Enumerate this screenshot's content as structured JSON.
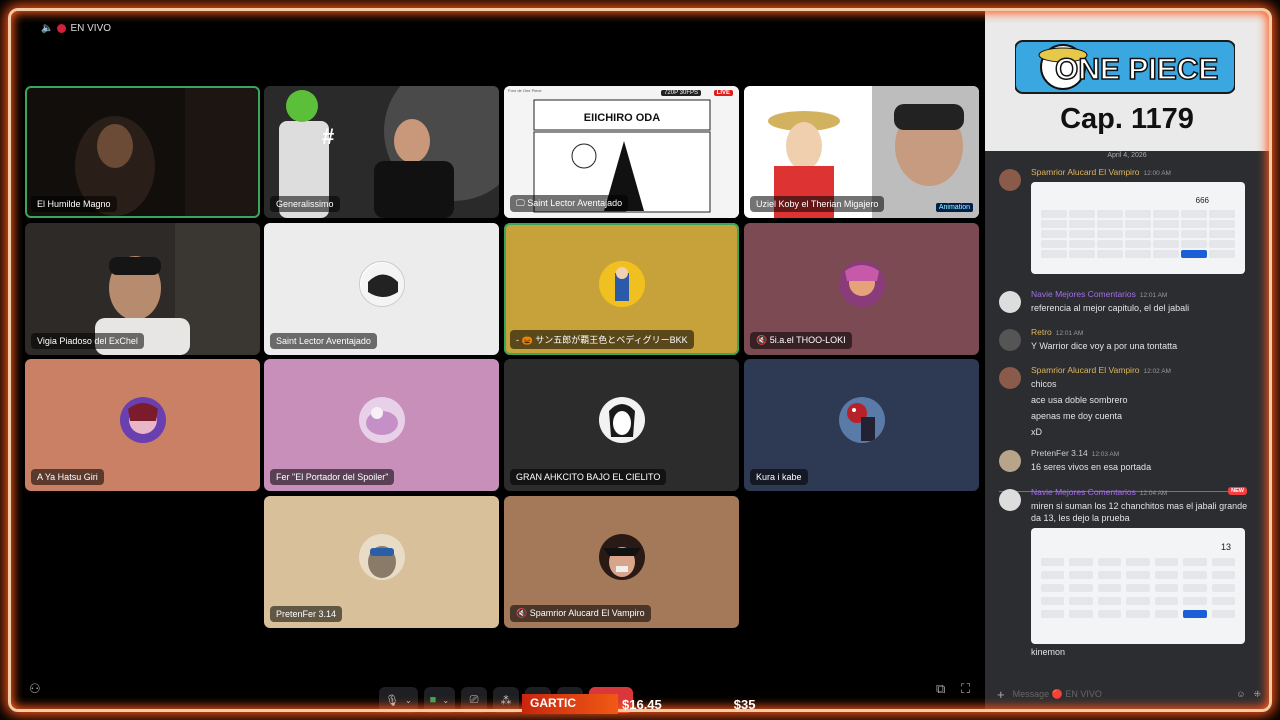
{
  "live_indicator": {
    "label": "EN VIVO"
  },
  "tiles": [
    {
      "name": "El Humilde Magno",
      "bg": "#1a1614"
    },
    {
      "name": "Generalissimo",
      "bg": "#2b2b2b"
    },
    {
      "name": "Saint Lector Aventajado",
      "bg": "#ffffff",
      "overlay": {
        "channel": "Foro de One Piece",
        "quality": "720P 30FPS",
        "live": "LIVE",
        "headline": "EIICHIRO ODA"
      }
    },
    {
      "name": "Uziel Koby el Therian Migajero",
      "bg": "#c5c5c5",
      "overlay": {
        "sponsor": "Animation"
      }
    },
    {
      "name": "Vigia Piadoso del ExChel",
      "bg": "#2d2a28"
    },
    {
      "name": "Saint Lector Aventajado",
      "bg": "#ececec"
    },
    {
      "name": "- 🎃 サン五郎が覇王色とベディグリーBKK",
      "bg": "#c7a13a"
    },
    {
      "name": "5i.a.el THOO-LOKI",
      "bg": "#7c4a52"
    },
    {
      "name": "A Ya Hatsu Giri",
      "bg": "#c98064"
    },
    {
      "name": "Fer \"El Portador del Spoiler\"",
      "bg": "#c78fba"
    },
    {
      "name": "GRAN AHKCITO BAJO EL CIELITO",
      "bg": "#2c2c2c"
    },
    {
      "name": "Kura i kabe",
      "bg": "#2e3953"
    },
    {
      "name": "PretenFer 3.14",
      "bg": "#d8c09a"
    },
    {
      "name": "Spamrior Alucard El Vampiro",
      "bg": "#a3795a"
    }
  ],
  "sidebar": {
    "logo_text": "ONE PIECE",
    "chapter": "Cap. 1179",
    "date": "April 4, 2026",
    "new_label": "NEW",
    "messages": [
      {
        "user": "Spamrior Alucard El Vampiro",
        "time": "12:00 AM",
        "lines": [],
        "calc_display": "666"
      },
      {
        "user": "Navie Mejores Comentarios",
        "time": "12:01 AM",
        "lines": [
          "referencia al mejor capitulo, el del jabali"
        ]
      },
      {
        "user": "Retro",
        "time": "12:01 AM",
        "lines": [
          "Y Warrior dice voy a por una tontatta"
        ]
      },
      {
        "user": "Spamrior Alucard El Vampiro",
        "time": "12:02 AM",
        "lines": [
          "chicos",
          "ace usa doble sombrero",
          "apenas me doy cuenta",
          "xD"
        ]
      },
      {
        "user": "PretenFer 3.14",
        "time": "12:03 AM",
        "lines": [
          "16 seres vivos en esa portada"
        ]
      },
      {
        "user": "Navie Mejores Comentarios",
        "time": "12:04 AM",
        "lines": [
          "miren si suman los 12 chanchitos mas el jabali grande",
          "da 13, les dejo la prueba"
        ],
        "calc_display": "13"
      },
      {
        "user": "",
        "time": "",
        "lines": [
          "kinemon"
        ]
      }
    ],
    "composer_placeholder": "Message 🔴 EN VIVO"
  },
  "ticker": {
    "label": "GARTIC",
    "price1": "$16.45",
    "price2": "$35"
  },
  "colors": {
    "accent_orange": "#ff5a1a",
    "speaking_green": "#3ba55c",
    "end_call_red": "#da373c"
  }
}
